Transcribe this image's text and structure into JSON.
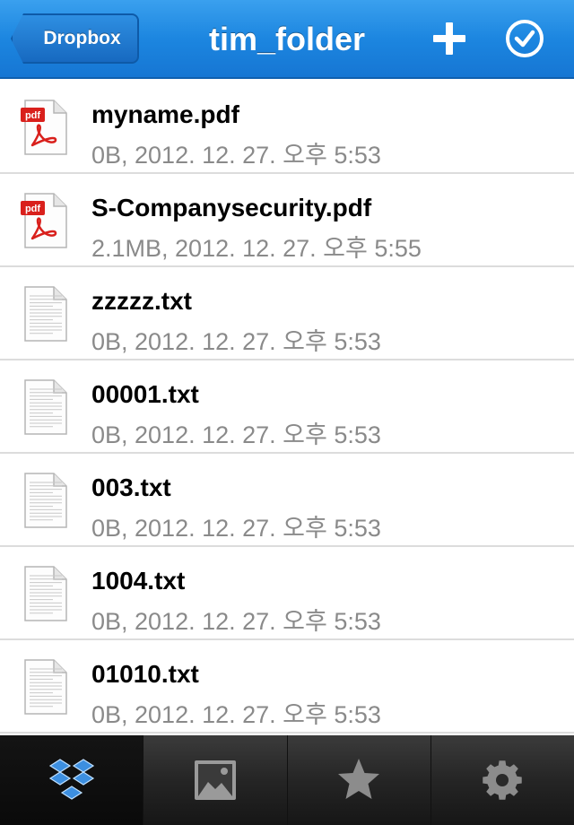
{
  "navbar": {
    "back_label": "Dropbox",
    "title": "tim_folder",
    "add_icon": "plus-icon",
    "select_icon": "checkmark-circle-icon"
  },
  "files": [
    {
      "name": "myname.pdf",
      "meta": "0B, 2012. 12. 27. 오후 5:53",
      "type": "pdf"
    },
    {
      "name": "S-Companysecurity.pdf",
      "meta": "2.1MB, 2012. 12. 27. 오후 5:55",
      "type": "pdf"
    },
    {
      "name": "zzzzz.txt",
      "meta": "0B, 2012. 12. 27. 오후 5:53",
      "type": "txt"
    },
    {
      "name": "00001.txt",
      "meta": "0B, 2012. 12. 27. 오후 5:53",
      "type": "txt"
    },
    {
      "name": "003.txt",
      "meta": "0B, 2012. 12. 27. 오후 5:53",
      "type": "txt"
    },
    {
      "name": "1004.txt",
      "meta": "0B, 2012. 12. 27. 오후 5:53",
      "type": "txt"
    },
    {
      "name": "01010.txt",
      "meta": "0B, 2012. 12. 27. 오후 5:53",
      "type": "txt"
    }
  ],
  "pdf_icon_label": "pdf",
  "tabbar": {
    "tabs": [
      {
        "icon": "dropbox-icon",
        "active": true
      },
      {
        "icon": "photo-icon",
        "active": false
      },
      {
        "icon": "star-icon",
        "active": false
      },
      {
        "icon": "gear-icon",
        "active": false
      }
    ]
  },
  "colors": {
    "navbar": "#1c86e0",
    "meta_text": "#8a8a8a",
    "pdf_red": "#d9201c",
    "tab_icon": "#8c8c8c",
    "dropbox_blue": "#3d8fe0"
  }
}
